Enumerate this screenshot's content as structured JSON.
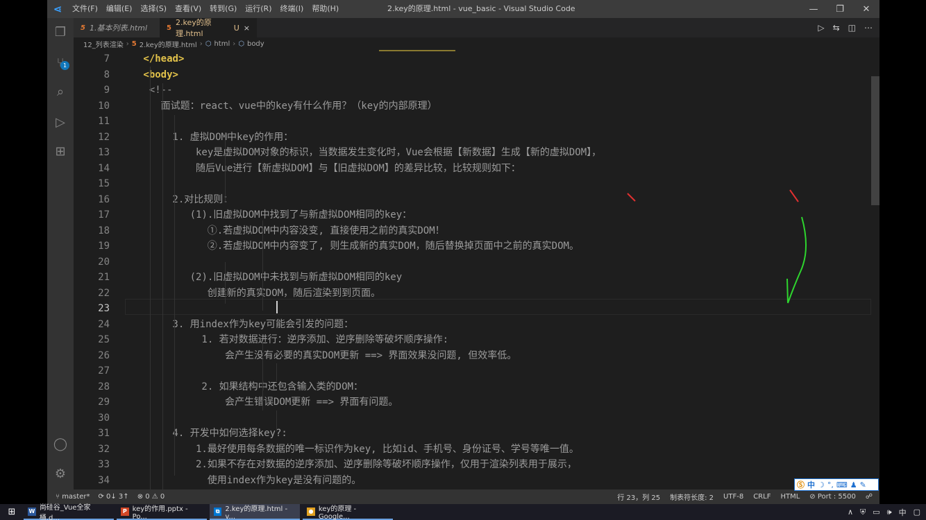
{
  "window": {
    "title": "2.key的原理.html - vue_basic - Visual Studio Code",
    "menu": [
      "文件(F)",
      "编辑(E)",
      "选择(S)",
      "查看(V)",
      "转到(G)",
      "运行(R)",
      "终端(I)",
      "帮助(H)"
    ]
  },
  "activity": {
    "scm_badge": "1"
  },
  "tabs": [
    {
      "label": "1.基本列表.html"
    },
    {
      "label": "2.key的原理.html",
      "status": "U",
      "close": "×"
    }
  ],
  "breadcrumb": [
    "12_列表渲染",
    "2.key的原理.html",
    "html",
    "body"
  ],
  "lines": [
    {
      "n": "7",
      "indent": 1,
      "text": "</head>",
      "tag": true
    },
    {
      "n": "8",
      "indent": 1,
      "text": "<body>",
      "tag": true
    },
    {
      "n": "9",
      "indent": 2,
      "text": "<!--"
    },
    {
      "n": "10",
      "indent": 4,
      "text": "面试题：react、vue中的key有什么作用？（key的内部原理）"
    },
    {
      "n": "11",
      "indent": 0,
      "text": ""
    },
    {
      "n": "12",
      "indent": 6,
      "text": "1. 虚拟DOM中key的作用："
    },
    {
      "n": "13",
      "indent": 10,
      "text": "key是虚拟DOM对象的标识，当数据发生变化时，Vue会根据【新数据】生成【新的虚拟DOM】，"
    },
    {
      "n": "14",
      "indent": 10,
      "text": "随后Vue进行【新虚拟DOM】与【旧虚拟DOM】的差异比较，比较规则如下："
    },
    {
      "n": "15",
      "indent": 0,
      "text": ""
    },
    {
      "n": "16",
      "indent": 6,
      "text": "2.对比规则："
    },
    {
      "n": "17",
      "indent": 9,
      "text": "(1).旧虚拟DOM中找到了与新虚拟DOM相同的key："
    },
    {
      "n": "18",
      "indent": 12,
      "text": "①.若虚拟DOM中内容没变, 直接使用之前的真实DOM！"
    },
    {
      "n": "19",
      "indent": 12,
      "text": "②.若虚拟DOM中内容变了, 则生成新的真实DOM，随后替换掉页面中之前的真实DOM。"
    },
    {
      "n": "20",
      "indent": 0,
      "text": ""
    },
    {
      "n": "21",
      "indent": 9,
      "text": "(2).旧虚拟DOM中未找到与新虚拟DOM相同的key"
    },
    {
      "n": "22",
      "indent": 12,
      "text": "创建新的真实DOM，随后渲染到到页面。"
    },
    {
      "n": "23",
      "indent": 0,
      "text": "",
      "current": true
    },
    {
      "n": "24",
      "indent": 6,
      "text": "3. 用index作为key可能会引发的问题："
    },
    {
      "n": "25",
      "indent": 11,
      "text": "1. 若对数据进行：逆序添加、逆序删除等破坏顺序操作:"
    },
    {
      "n": "26",
      "indent": 15,
      "text": "会产生没有必要的真实DOM更新 ==> 界面效果没问题, 但效率低。"
    },
    {
      "n": "27",
      "indent": 0,
      "text": ""
    },
    {
      "n": "28",
      "indent": 11,
      "text": "2. 如果结构中还包含输入类的DOM："
    },
    {
      "n": "29",
      "indent": 15,
      "text": "会产生错误DOM更新 ==> 界面有问题。"
    },
    {
      "n": "30",
      "indent": 0,
      "text": ""
    },
    {
      "n": "31",
      "indent": 6,
      "text": "4. 开发中如何选择key?:"
    },
    {
      "n": "32",
      "indent": 10,
      "text": "1.最好使用每条数据的唯一标识作为key, 比如id、手机号、身份证号、学号等唯一值。"
    },
    {
      "n": "33",
      "indent": 10,
      "text": "2.如果不存在对数据的逆序添加、逆序删除等破坏顺序操作，仅用于渲染列表用于展示，"
    },
    {
      "n": "34",
      "indent": 12,
      "text": "使用index作为key是没有问题的。"
    }
  ],
  "status": {
    "branch": "master*",
    "sync": "0↓ 3↑",
    "problems": "⊗ 0 ⚠ 0",
    "position": "行 23，列 25",
    "tab_size": "制表符长度: 2",
    "encoding": "UTF-8",
    "eol": "CRLF",
    "language": "HTML",
    "port": "⊘ Port : 5500"
  },
  "ime": {
    "mode": "中"
  },
  "taskbar": [
    {
      "icon": "W",
      "color": "#2b579a",
      "label": "尚硅谷_Vue全家桶.d..."
    },
    {
      "icon": "P",
      "color": "#d24726",
      "label": "key的作用.pptx - Po..."
    },
    {
      "icon": "⧉",
      "color": "#0078d4",
      "label": "2.key的原理.html - v...",
      "active": true
    },
    {
      "icon": "●",
      "color": "#e0a020",
      "label": "key的原理 - Google..."
    }
  ],
  "tray": {
    "lang": "中"
  }
}
